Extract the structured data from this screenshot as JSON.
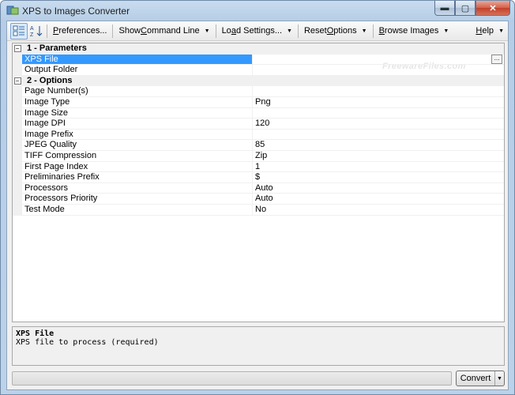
{
  "window": {
    "title": "XPS to Images Converter",
    "minimize_glyph": "▬",
    "maximize_glyph": "▢",
    "close_glyph": "✕"
  },
  "toolbar": {
    "categorized_icon": "categorized-view-icon",
    "alphabetical_icon": "sort-alphabetical-icon",
    "preferences": {
      "pre": "",
      "key": "P",
      "post": "references..."
    },
    "show_command_line": {
      "pre": "Show ",
      "key": "C",
      "post": "ommand Line"
    },
    "load_settings": {
      "pre": "Lo",
      "key": "a",
      "post": "d Settings..."
    },
    "reset_options": {
      "pre": "Reset ",
      "key": "O",
      "post": "ptions"
    },
    "browse_images": {
      "pre": "",
      "key": "B",
      "post": "rowse Images"
    },
    "help": {
      "pre": "",
      "key": "H",
      "post": "elp"
    },
    "dropdown_glyph": "▼"
  },
  "grid": {
    "watermark": "FreewareFiles.com",
    "ellipsis": "...",
    "categories": [
      {
        "label": "1 - Parameters",
        "toggle": "−",
        "properties": [
          {
            "name": "XPS File",
            "value": ""
          },
          {
            "name": "Output Folder",
            "value": ""
          }
        ]
      },
      {
        "label": "2 - Options",
        "toggle": "−",
        "properties": [
          {
            "name": "Page Number(s)",
            "value": ""
          },
          {
            "name": "Image Type",
            "value": "Png"
          },
          {
            "name": "Image Size",
            "value": ""
          },
          {
            "name": "Image DPI",
            "value": "120"
          },
          {
            "name": "Image Prefix",
            "value": ""
          },
          {
            "name": "JPEG Quality",
            "value": "85"
          },
          {
            "name": "TIFF Compression",
            "value": "Zip"
          },
          {
            "name": "First Page Index",
            "value": "1"
          },
          {
            "name": "Preliminaries Prefix",
            "value": "$"
          },
          {
            "name": "Processors",
            "value": "Auto"
          },
          {
            "name": "Processors Priority",
            "value": "Auto"
          },
          {
            "name": "Test Mode",
            "value": "No"
          }
        ]
      }
    ]
  },
  "description": {
    "title": "XPS File",
    "text": "XPS file to process (required)"
  },
  "progress": {
    "value": 0
  },
  "convert_button": {
    "label": "Convert",
    "dropdown_glyph": "▼"
  }
}
